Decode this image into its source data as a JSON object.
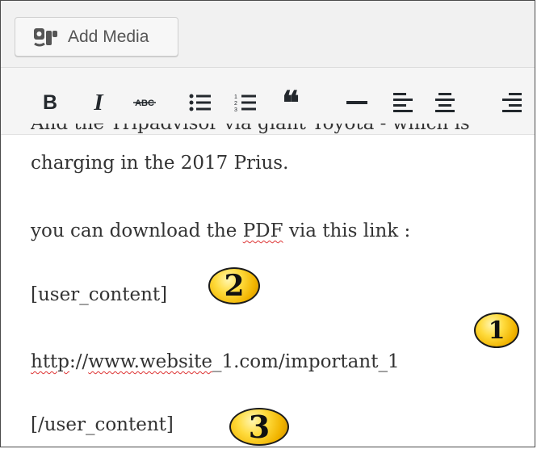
{
  "media_bar": {
    "add_media_label": "Add Media"
  },
  "toolbar": {
    "bold_glyph": "B",
    "italic_glyph": "I",
    "strikethrough_glyph": "ABC",
    "blockquote_glyph": "❝"
  },
  "content": {
    "partial_line": "And the Tripadvisor via giant Toyota - which is",
    "line1": "charging in the 2017 Prius.",
    "line2_pre": "you can download the ",
    "line2_link": "PDF",
    "line2_post": " via this link :",
    "line3": "[user_content]",
    "line4_a": "http",
    "line4_b": "://",
    "line4_c": "www.website",
    "line4_d": "_1.com/important_1",
    "line5": "[/user_content]"
  },
  "annotations": {
    "badge_1": "1",
    "badge_2": "2",
    "badge_3": "3",
    "badge_color": "#ffd21f"
  }
}
